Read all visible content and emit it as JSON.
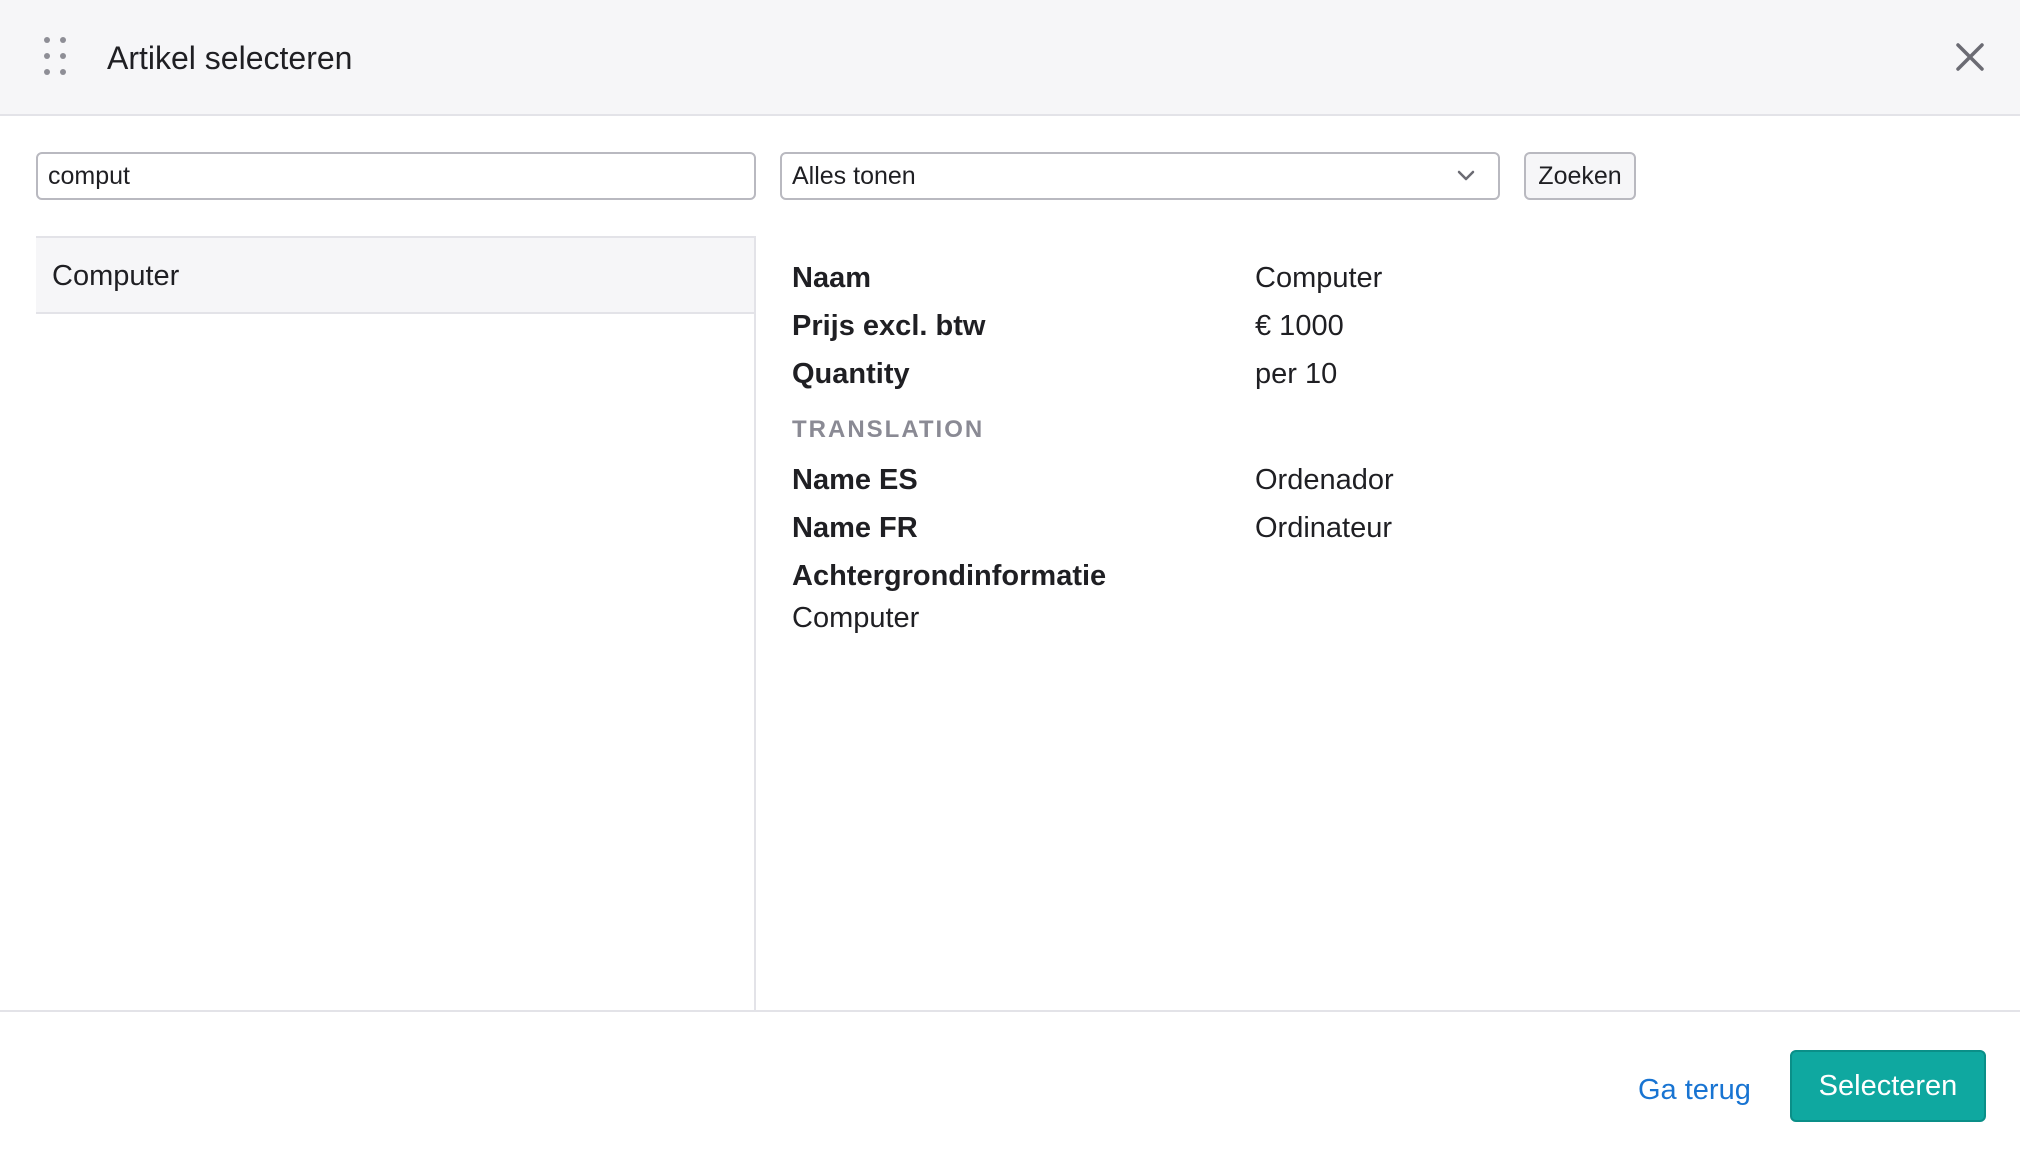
{
  "dialog": {
    "title": "Artikel selecteren"
  },
  "toolbar": {
    "search_value": "comput",
    "filter_selected": "Alles tonen",
    "search_button_label": "Zoeken"
  },
  "results": [
    {
      "label": "Computer"
    }
  ],
  "details": {
    "fields": [
      {
        "label": "Naam",
        "value": "Computer"
      },
      {
        "label": "Prijs excl. btw",
        "value": "€ 1000"
      },
      {
        "label": "Quantity",
        "value": "per 10"
      }
    ],
    "translation_heading": "TRANSLATION",
    "translations": [
      {
        "label": "Name ES",
        "value": "Ordenador"
      },
      {
        "label": "Name FR",
        "value": "Ordinateur"
      }
    ],
    "background_label": "Achtergrondinformatie",
    "background_value": "Computer"
  },
  "footer": {
    "back_label": "Ga terug",
    "select_label": "Selecteren"
  },
  "colors": {
    "header_bg": "#f6f6f8",
    "accent": "#0fa8a0",
    "link": "#1874d2",
    "muted_heading": "#8a8a94"
  },
  "icons": {
    "drag": "drag-handle-icon",
    "close": "close-icon",
    "dropdown": "chevron-down-icon"
  }
}
